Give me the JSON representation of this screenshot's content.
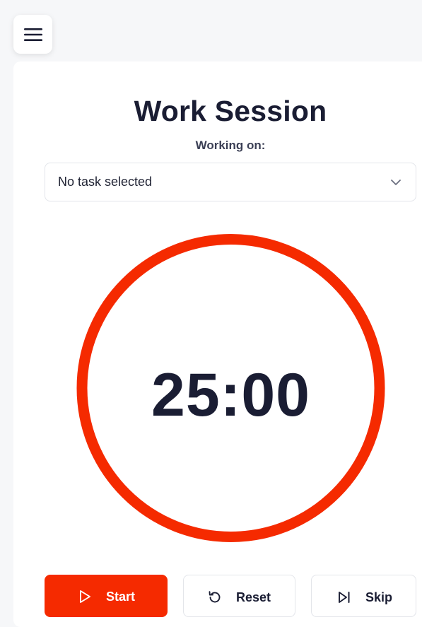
{
  "menu": {
    "icon": "hamburger-menu-icon"
  },
  "session": {
    "title": "Work Session",
    "working_on_label": "Working on:",
    "task_select": {
      "value": "No task selected",
      "icon": "chevron-down-icon"
    }
  },
  "timer": {
    "display": "25:00",
    "progress": 1.0,
    "ring_color": "#f52a00"
  },
  "controls": {
    "start": {
      "label": "Start",
      "icon": "play-icon",
      "color": "#f52a00"
    },
    "reset": {
      "label": "Reset",
      "icon": "reset-icon"
    },
    "skip": {
      "label": "Skip",
      "icon": "skip-next-icon"
    }
  }
}
